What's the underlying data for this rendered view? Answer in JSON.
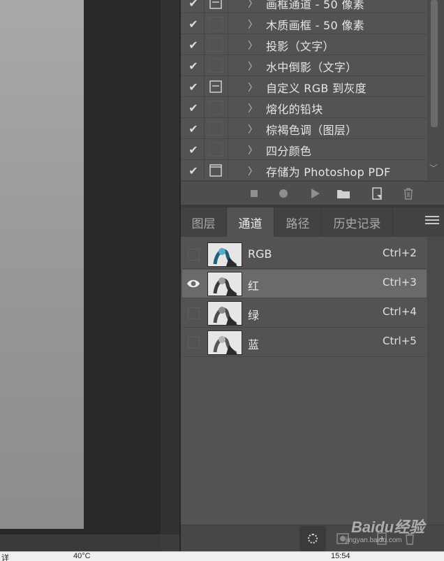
{
  "actions": {
    "items": [
      {
        "label": "画框通道 - 50 像素",
        "checked": true,
        "dialog": "mark"
      },
      {
        "label": "木质画框 - 50 像素",
        "checked": true,
        "dialog": "empty"
      },
      {
        "label": "投影（文字）",
        "checked": true,
        "dialog": "empty"
      },
      {
        "label": "水中倒影（文字）",
        "checked": true,
        "dialog": "empty"
      },
      {
        "label": "自定义 RGB 到灰度",
        "checked": true,
        "dialog": "mark"
      },
      {
        "label": "熔化的铅块",
        "checked": true,
        "dialog": "empty"
      },
      {
        "label": "棕褐色调（图层）",
        "checked": true,
        "dialog": "empty"
      },
      {
        "label": "四分颜色",
        "checked": true,
        "dialog": "empty"
      },
      {
        "label": "存储为 Photoshop PDF",
        "checked": true,
        "dialog": "frame"
      }
    ],
    "toolbar_icons": [
      "stop-icon",
      "record-icon",
      "play-icon",
      "new-set-folder-icon",
      "new-action-icon",
      "delete-trash-icon"
    ]
  },
  "tabs": [
    {
      "label": "图层",
      "active": false
    },
    {
      "label": "通道",
      "active": true
    },
    {
      "label": "路径",
      "active": false
    },
    {
      "label": "历史记录",
      "active": false
    }
  ],
  "channels": [
    {
      "name": "RGB",
      "shortcut": "Ctrl+2",
      "visible": false,
      "selected": false
    },
    {
      "name": "红",
      "shortcut": "Ctrl+3",
      "visible": true,
      "selected": true
    },
    {
      "name": "绿",
      "shortcut": "Ctrl+4",
      "visible": false,
      "selected": false
    },
    {
      "name": "蓝",
      "shortcut": "Ctrl+5",
      "visible": false,
      "selected": false
    }
  ],
  "footer_icons": [
    "load-channel-as-selection-icon",
    "save-selection-as-channel-icon",
    "new-channel-icon",
    "delete-channel-icon"
  ],
  "watermark": {
    "brand": "Baidu经验",
    "url": "jingyan.baidu.com"
  },
  "status_bar": {
    "left": "详",
    "middle": "40°C",
    "time": "15:54"
  },
  "colors": {
    "panel_bg": "#535353",
    "selected_row": "#6a6a6a",
    "tab_bar": "#424242"
  }
}
